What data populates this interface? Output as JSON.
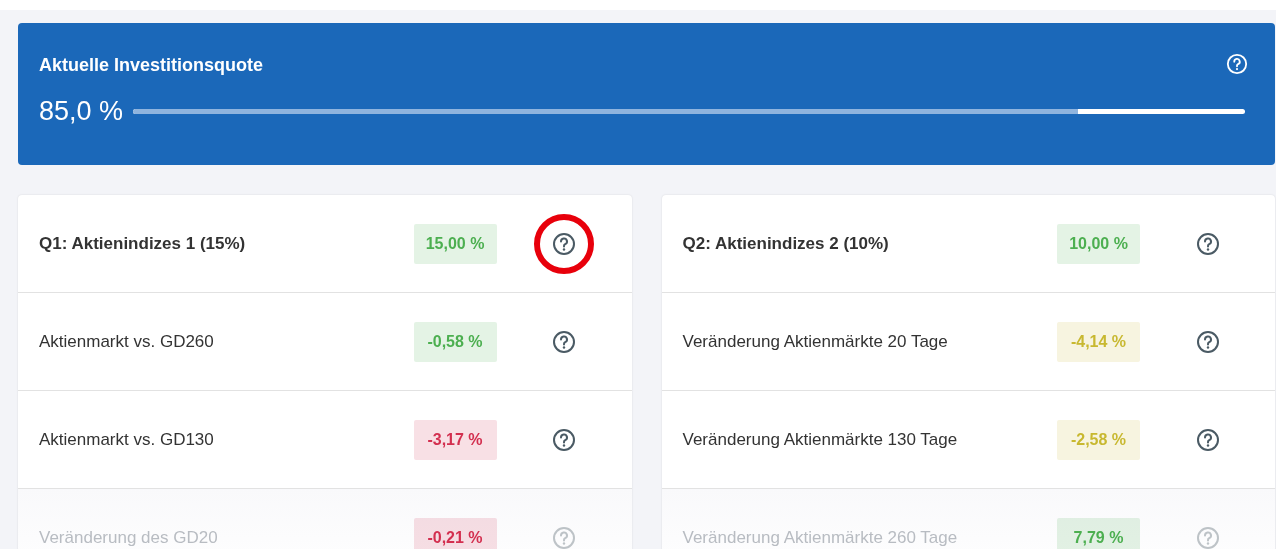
{
  "quota": {
    "title": "Aktuelle Investitionsquote",
    "value": "85,0 %",
    "level": 0.85
  },
  "panels": [
    {
      "rows": [
        {
          "label": "Q1: Aktienindizes 1 (15%)",
          "header": true,
          "value": "15,00 %",
          "color": "#4caf50",
          "highlighted": true,
          "faded": false
        },
        {
          "label": "Aktienmarkt vs. GD260",
          "header": false,
          "value": "-0,58 %",
          "color": "#4caf50",
          "highlighted": false,
          "faded": false
        },
        {
          "label": "Aktienmarkt vs. GD130",
          "header": false,
          "value": "-3,17 %",
          "color": "#d32f4f",
          "highlighted": false,
          "faded": false
        },
        {
          "label": "Veränderung des GD20",
          "header": false,
          "value": "-0,21 %",
          "color": "#d32f4f",
          "highlighted": false,
          "faded": true
        }
      ]
    },
    {
      "rows": [
        {
          "label": "Q2: Aktienindizes 2 (10%)",
          "header": true,
          "value": "10,00 %",
          "color": "#4caf50",
          "highlighted": false,
          "faded": false
        },
        {
          "label": "Veränderung Aktienmärkte 20 Tage",
          "header": false,
          "value": "-4,14 %",
          "color": "#c8b830",
          "highlighted": false,
          "faded": false
        },
        {
          "label": "Veränderung Aktienmärkte 130 Tage",
          "header": false,
          "value": "-2,58 %",
          "color": "#c8b830",
          "highlighted": false,
          "faded": false
        },
        {
          "label": "Veränderung Aktienmärkte 260 Tage",
          "header": false,
          "value": "7,79 %",
          "color": "#4caf50",
          "highlighted": false,
          "faded": true
        }
      ]
    }
  ]
}
